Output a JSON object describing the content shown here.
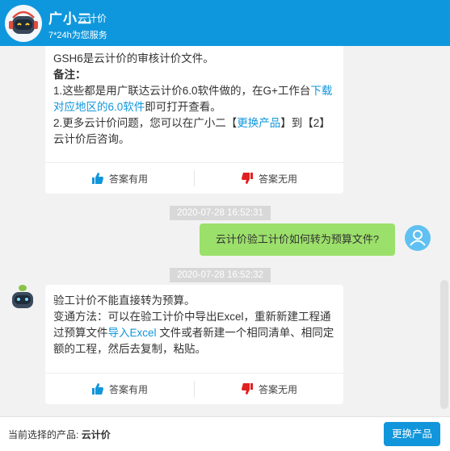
{
  "header": {
    "title": "广小二",
    "subtitle": "云计价",
    "service_hours": "7*24h为您服务"
  },
  "messages": {
    "card1": {
      "partial_line": "GSH6是云计价的审核计价文件。",
      "note_title": "备注：",
      "note1_a": "1.这些都是用广联达云计价6.0软件做的，在G+工作台",
      "note1_link": "下载对应地区的6.0软件",
      "note1_b": "即可打开查看。",
      "note2_a": "2.更多云计价问题，您可以在广小二【",
      "note2_link": "更换产品",
      "note2_b": "】到【2】云计价后咨询。"
    },
    "time1": "2020-07-28 16:52:31",
    "user_question": "云计价验工计价如何转为预算文件?",
    "time2": "2020-07-28 16:52:32",
    "card2": {
      "line1": "验工计价不能直接转为预算。",
      "line2_a": "变通方法：可以在验工计价中导出Excel，重新新建工程通过预算文件",
      "line2_link": "导入Excel",
      "line2_b": " 文件或者新建一个相同清单、相同定额的工程，然后去复制，粘贴。"
    },
    "helpful_label": "答案有用",
    "unhelpful_label": "答案无用"
  },
  "footer": {
    "current_label": "当前选择的产品:",
    "current_product": "云计价",
    "switch_button": "更换产品"
  },
  "colors": {
    "header_bg": "#0f97dd",
    "link": "#1296db",
    "user_bubble": "#9be06a",
    "thumb_up": "#1296db",
    "thumb_down": "#e02020"
  }
}
